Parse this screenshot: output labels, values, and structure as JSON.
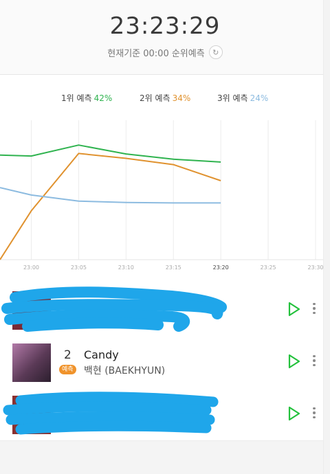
{
  "header": {
    "clock": "23:23:29",
    "subtitle": "현재기준 00:00 순위예측"
  },
  "legend": [
    {
      "label": "1위 예측",
      "percent": "42%",
      "color": "#2fb34f"
    },
    {
      "label": "2위 예측",
      "percent": "34%",
      "color": "#e0922f"
    },
    {
      "label": "3위 예측",
      "percent": "24%",
      "color": "#8cbbe0"
    }
  ],
  "chart_data": {
    "type": "line",
    "x": [
      "23:00",
      "23:05",
      "23:10",
      "23:15",
      "23:20",
      "23:25",
      "23:30"
    ],
    "xlim_minutes_after_2300": [
      -3.3,
      30.8
    ],
    "ylim_percent": [
      0,
      60
    ],
    "grid": true,
    "series": [
      {
        "color": "#2fb34f",
        "points": [
          [
            -3.3,
            45
          ],
          [
            0,
            44.6
          ],
          [
            5,
            49.3
          ],
          [
            10,
            45.5
          ],
          [
            15,
            43.2
          ],
          [
            20,
            42
          ]
        ]
      },
      {
        "color": "#e0922f",
        "points": [
          [
            -3.3,
            0
          ],
          [
            0,
            21
          ],
          [
            5,
            45.7
          ],
          [
            10,
            43.6
          ],
          [
            15,
            40.9
          ],
          [
            20,
            34
          ]
        ]
      },
      {
        "color": "#8cbbe0",
        "points": [
          [
            -3.3,
            31
          ],
          [
            0,
            27.8
          ],
          [
            5,
            25.2
          ],
          [
            10,
            24.6
          ],
          [
            15,
            24.4
          ],
          [
            20,
            24.4
          ]
        ]
      }
    ]
  },
  "list": [
    {
      "rank": "",
      "title": "",
      "artist": "",
      "badge": "",
      "thumb": "#7a2a35",
      "redacted": true
    },
    {
      "rank": "2",
      "title": "Candy",
      "artist": "백현 (BAEKHYUN)",
      "badge": "예측",
      "thumb": "#6a4060",
      "redacted": false
    },
    {
      "rank": "",
      "title": "",
      "artist": "",
      "badge": "",
      "thumb": "#8a3030",
      "redacted": true
    }
  ],
  "colors": {
    "accent": "#23c13c",
    "badge": "#f0932b"
  }
}
